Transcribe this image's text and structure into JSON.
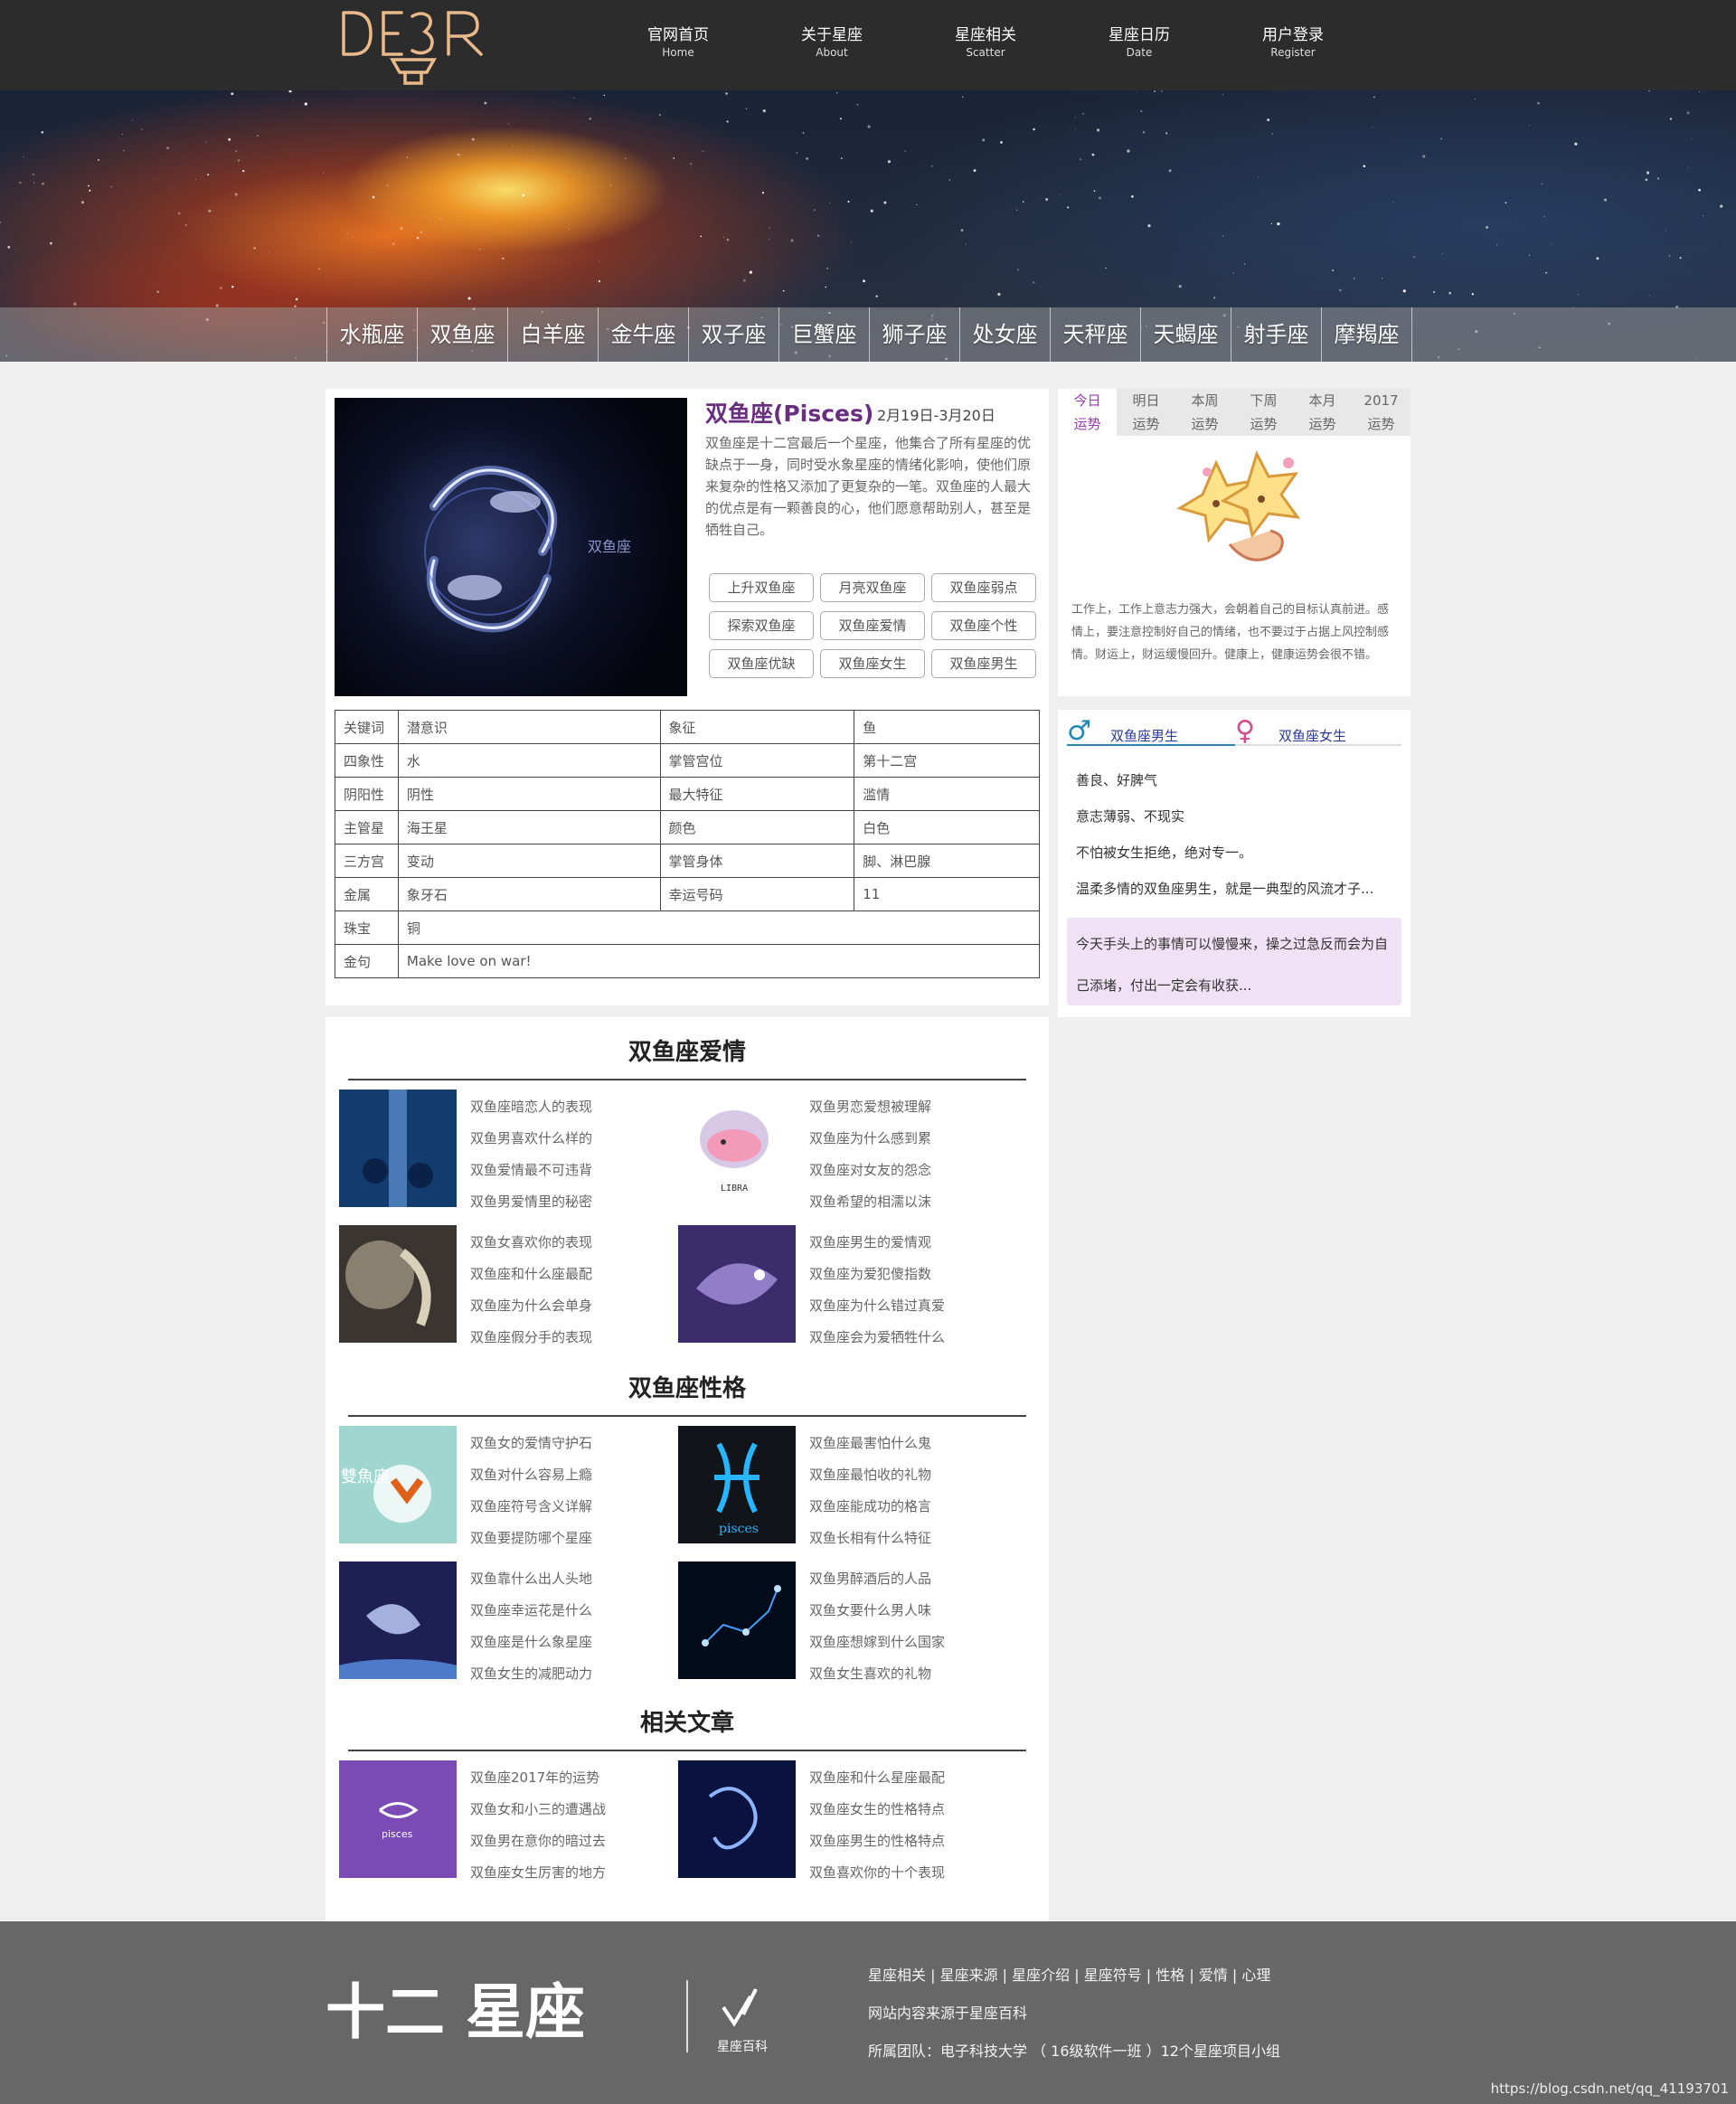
{
  "header": {
    "logo_text": "DE3R",
    "nav": [
      {
        "zh": "官网首页",
        "en": "Home"
      },
      {
        "zh": "关于星座",
        "en": "About"
      },
      {
        "zh": "星座相关",
        "en": "Scatter"
      },
      {
        "zh": "星座日历",
        "en": "Date"
      },
      {
        "zh": "用户登录",
        "en": "Register"
      }
    ]
  },
  "signs": [
    "水瓶座",
    "双鱼座",
    "白羊座",
    "金牛座",
    "双子座",
    "巨蟹座",
    "狮子座",
    "处女座",
    "天秤座",
    "天蝎座",
    "射手座",
    "摩羯座"
  ],
  "profile": {
    "title": "双鱼座(Pisces)",
    "date": "2月19日-3月20日",
    "desc": "双鱼座是十二宫最后一个星座，他集合了所有星座的优缺点于一身，同时受水象星座的情绪化影响，使他们原来复杂的性格又添加了更复杂的一笔。双鱼座的人最大的优点是有一颗善良的心，他们愿意帮助别人，甚至是牺牲自己。",
    "image_label": "双鱼座",
    "tags": [
      "上升双鱼座",
      "月亮双鱼座",
      "双鱼座弱点",
      "探索双鱼座",
      "双鱼座爱情",
      "双鱼座个性",
      "双鱼座优缺",
      "双鱼座女生",
      "双鱼座男生"
    ],
    "attrs": [
      [
        "关键词",
        "潜意识",
        "象征",
        "鱼"
      ],
      [
        "四象性",
        "水",
        "掌管宫位",
        "第十二宫"
      ],
      [
        "阴阳性",
        "阴性",
        "最大特征",
        "滥情"
      ],
      [
        "主管星",
        "海王星",
        "颜色",
        "白色"
      ],
      [
        "三方宫",
        "变动",
        "掌管身体",
        "脚、淋巴腺"
      ],
      [
        "金属",
        "象牙石",
        "幸运号码",
        "11"
      ]
    ],
    "attrs_wide": [
      [
        "珠宝",
        "铜"
      ],
      [
        "金句",
        "Make love on war!"
      ]
    ]
  },
  "fortune": {
    "tabs": [
      [
        "今日",
        "运势"
      ],
      [
        "明日",
        "运势"
      ],
      [
        "本周",
        "运势"
      ],
      [
        "下周",
        "运势"
      ],
      [
        "本月",
        "运势"
      ],
      [
        "2017",
        "运势"
      ]
    ],
    "text": "工作上，工作上意志力强大，会朝着自己的目标认真前进。感情上，要注意控制好自己的情绪，也不要过于占据上风控制感情。财运上，财运缓慢回升。健康上，健康运势会很不错。"
  },
  "gender": {
    "male_tab": "双鱼座男生",
    "female_tab": "双鱼座女生",
    "male_symbol": "♂",
    "female_symbol": "♀",
    "items": [
      "善良、好脾气",
      "意志薄弱、不现实",
      "不怕被女生拒绝，绝对专一。",
      "温柔多情的双鱼座男生，就是一典型的风流才子..."
    ],
    "quote": "今天手头上的事情可以慢慢来，操之过急反而会为自己添堵，付出一定会有收获..."
  },
  "sections": [
    {
      "title": "双鱼座爱情",
      "blocks": [
        {
          "links": [
            "双鱼座暗恋人的表现",
            "双鱼男喜欢什么样的",
            "双鱼爱情最不可违背",
            "双鱼男爱情里的秘密"
          ]
        },
        {
          "links": [
            "双鱼男恋爱想被理解",
            "双鱼座为什么感到累",
            "双鱼座对女友的怨念",
            "双鱼希望的相濡以沫"
          ],
          "caption": "LIBRA"
        },
        {
          "links": [
            "双鱼女喜欢你的表现",
            "双鱼座和什么座最配",
            "双鱼座为什么会单身",
            "双鱼座假分手的表现"
          ]
        },
        {
          "links": [
            "双鱼座男生的爱情观",
            "双鱼座为爱犯傻指数",
            "双鱼座为什么错过真爱",
            "双鱼座会为爱牺牲什么"
          ]
        }
      ]
    },
    {
      "title": "双鱼座性格",
      "blocks": [
        {
          "links": [
            "双鱼女的爱情守护石",
            "双鱼对什么容易上瘾",
            "双鱼座符号含义详解",
            "双鱼要提防哪个星座"
          ],
          "caption": "雙魚座"
        },
        {
          "links": [
            "双鱼座最害怕什么鬼",
            "双鱼座最怕收的礼物",
            "双鱼座能成功的格言",
            "双鱼长相有什么特征"
          ],
          "caption": "pisces"
        },
        {
          "links": [
            "双鱼靠什么出人头地",
            "双鱼座幸运花是什么",
            "双鱼座是什么象星座",
            "双鱼女生的减肥动力"
          ]
        },
        {
          "links": [
            "双鱼男醉酒后的人品",
            "双鱼女要什么男人味",
            "双鱼座想嫁到什么国家",
            "双鱼女生喜欢的礼物"
          ]
        }
      ]
    },
    {
      "title": "相关文章",
      "blocks": [
        {
          "links": [
            "双鱼座2017年的运势",
            "双鱼女和小三的遭遇战",
            "双鱼男在意你的暗过去",
            "双鱼座女生厉害的地方"
          ],
          "caption": "pisces"
        },
        {
          "links": [
            "双鱼座和什么星座最配",
            "双鱼座女生的性格特点",
            "双鱼座男生的性格特点",
            "双鱼喜欢你的十个表现"
          ]
        }
      ]
    }
  ],
  "footer": {
    "logo_text": "十二 星座",
    "badge_text": "星座百科",
    "links": "星座相关 | 星座来源 | 星座介绍 | 星座符号 | 性格 | 爱情 | 心理",
    "source": "网站内容来源于星座百科",
    "team": "所属团队：电子科技大学 （ 16级软件一班 ）12个星座项目小组",
    "watermark": "https://blog.csdn.net/qq_41193701"
  }
}
